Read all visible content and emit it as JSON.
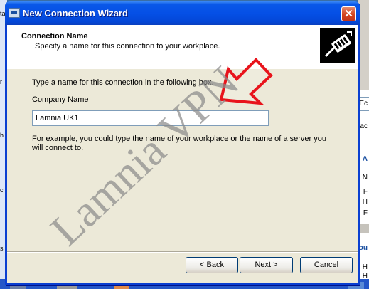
{
  "window": {
    "title": "New Connection Wizard"
  },
  "header": {
    "title": "Connection Name",
    "subtitle": "Specify a name for this connection to your workplace."
  },
  "form": {
    "prompt": "Type a name for this connection in the following box.",
    "field_label": "Company Name",
    "company_name_value": "Lamnia UK1",
    "example_text": "For example, you could type the name of your workplace or the name of a server you will connect to."
  },
  "buttons": {
    "back": "< Back",
    "next": "Next >",
    "cancel": "Cancel"
  },
  "watermark": {
    "text": "Lamnia VPN"
  },
  "background": {
    "right_texts": [
      "Ec",
      "Bac",
      "e A",
      "N",
      "F",
      "H",
      "F",
      "ou",
      "H",
      "H"
    ],
    "left_glyphs": [
      "ta",
      "r",
      "h",
      "c",
      "s"
    ]
  },
  "colors": {
    "title_bar": "#0550e6",
    "dialog_bg": "#ece9d8",
    "close_button": "#d3451f",
    "annotation_arrow": "#e8141c",
    "watermark": "#8a8a8a"
  },
  "icons": {
    "title": "wizard-window-icon",
    "header": "network-cable-icon",
    "close": "close-icon",
    "annotation": "red-arrow-icon"
  }
}
